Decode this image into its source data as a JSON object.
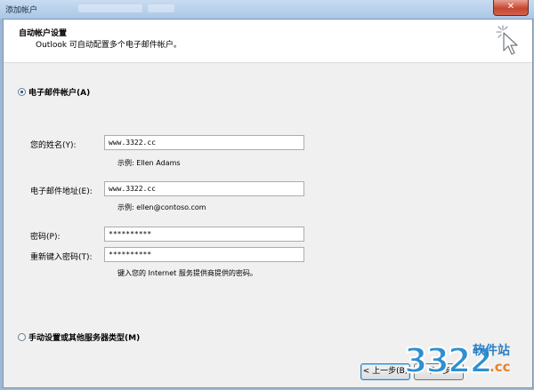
{
  "window": {
    "title": "添加帐户",
    "close_glyph": "✕"
  },
  "header": {
    "title": "自动帐户设置",
    "subtitle": "Outlook 可自动配置多个电子邮件帐户。"
  },
  "options": {
    "email_account_label": "电子邮件帐户(A)",
    "email_account_selected": true,
    "manual_setup_label": "手动设置或其他服务器类型(M)",
    "manual_setup_selected": false
  },
  "form": {
    "name_label": "您的姓名(Y):",
    "name_value": "www.3322.cc",
    "name_hint": "示例: Ellen Adams",
    "email_label": "电子邮件地址(E):",
    "email_value": "www.3322.cc",
    "email_hint": "示例: ellen@contoso.com",
    "password_label": "密码(P):",
    "password_value": "**********",
    "retype_label": "重新键入密码(T):",
    "retype_value": "**********",
    "password_hint": "键入您的 Internet 服务提供商提供的密码。"
  },
  "footer": {
    "back_label": "< 上一步(B)",
    "next_label": "下一步"
  },
  "watermark": {
    "number": "3322",
    "site_label": "软件站",
    "domain": ".cc"
  },
  "colors": {
    "titlebar": "#aac6e6",
    "close_button": "#c6462f",
    "dialog_bg": "#f0f0f0",
    "radio_dot": "#1c4e9c"
  }
}
